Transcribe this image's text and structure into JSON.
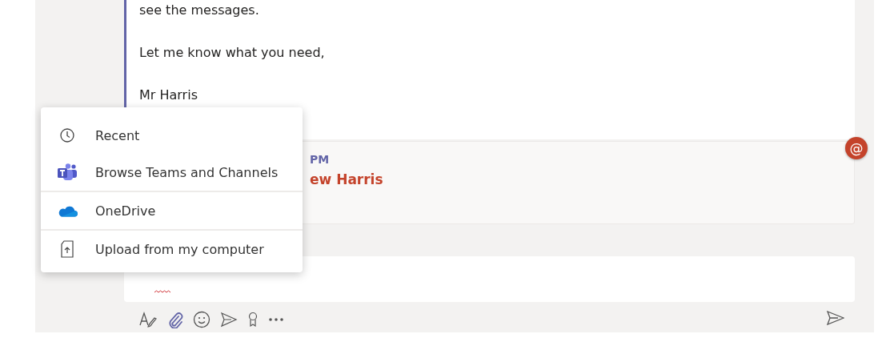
{
  "message": {
    "lines": [
      "see the messages.",
      "Let me know what you need,",
      "Mr Harris"
    ]
  },
  "reply_card": {
    "time": "PM",
    "author": "ew Harris",
    "mention_badge": "@"
  },
  "compose": {
    "spelling_error": true
  },
  "attach_menu": {
    "items": [
      {
        "kind": "clock",
        "label": "Recent",
        "separated": false
      },
      {
        "kind": "teams",
        "label": "Browse Teams and Channels",
        "separated": false
      },
      {
        "kind": "onedrive",
        "label": "OneDrive",
        "separated": true
      },
      {
        "kind": "upload",
        "label": "Upload from my computer",
        "separated": true
      }
    ]
  },
  "toolbar": {
    "tools": [
      {
        "kind": "format",
        "selected": false
      },
      {
        "kind": "attach",
        "selected": true
      },
      {
        "kind": "emoji",
        "selected": false
      },
      {
        "kind": "schedule",
        "selected": false
      },
      {
        "kind": "praise",
        "selected": false
      },
      {
        "kind": "more",
        "selected": false
      }
    ],
    "send": {
      "kind": "send"
    }
  }
}
